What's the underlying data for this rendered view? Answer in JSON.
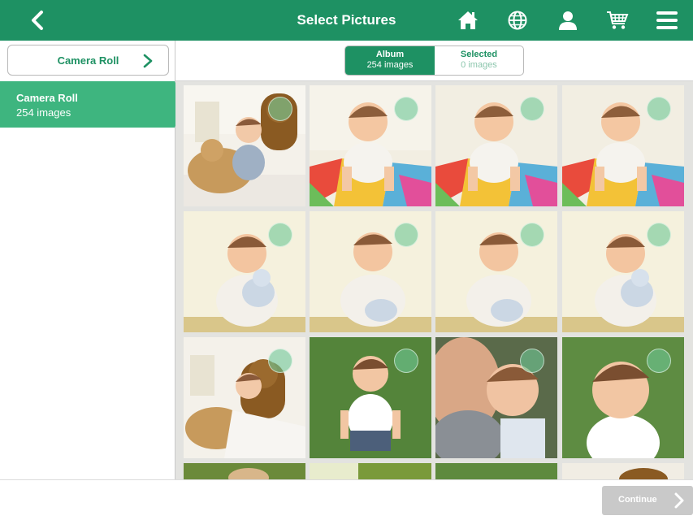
{
  "header": {
    "title": "Select Pictures",
    "background": "#1e9163",
    "icons": [
      "back-chevron-icon",
      "home-icon",
      "globe-icon",
      "user-icon",
      "cart-icon",
      "menu-icon"
    ]
  },
  "sidebar": {
    "source_button_label": "Camera Roll",
    "albums": [
      {
        "name": "Camera Roll",
        "count": "254 images"
      }
    ]
  },
  "tabs": {
    "album": {
      "label": "Album",
      "count": "254 images"
    },
    "selected": {
      "label": "Selected",
      "count": "0 images"
    }
  },
  "photos": [
    {
      "scene": "teddy-bear-room"
    },
    {
      "scene": "colorful-blanket"
    },
    {
      "scene": "colorful-blanket"
    },
    {
      "scene": "colorful-blanket"
    },
    {
      "scene": "cream-toy"
    },
    {
      "scene": "cream-toy"
    },
    {
      "scene": "cream-toy"
    },
    {
      "scene": "cream-toy"
    },
    {
      "scene": "teddy-bear-room"
    },
    {
      "scene": "grass"
    },
    {
      "scene": "dad-hug"
    },
    {
      "scene": "grass-closeup"
    }
  ],
  "footer": {
    "continue_label": "Continue"
  }
}
